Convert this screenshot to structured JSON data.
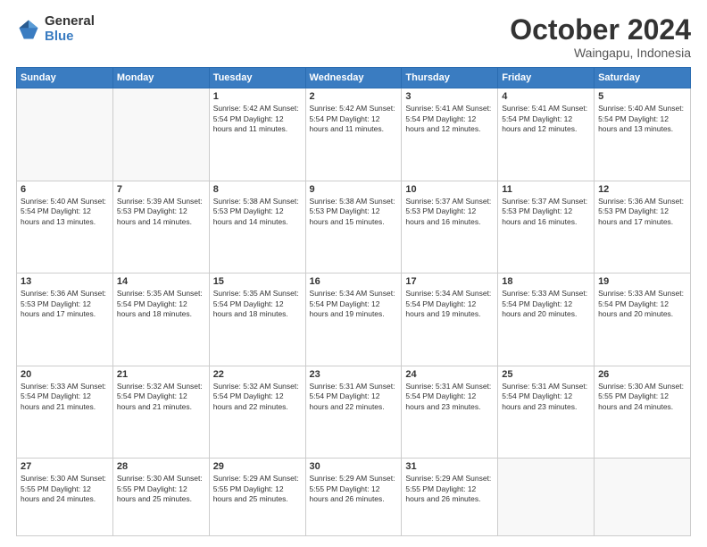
{
  "logo": {
    "general": "General",
    "blue": "Blue"
  },
  "header": {
    "month": "October 2024",
    "location": "Waingapu, Indonesia"
  },
  "weekdays": [
    "Sunday",
    "Monday",
    "Tuesday",
    "Wednesday",
    "Thursday",
    "Friday",
    "Saturday"
  ],
  "weeks": [
    [
      {
        "day": "",
        "info": ""
      },
      {
        "day": "",
        "info": ""
      },
      {
        "day": "1",
        "info": "Sunrise: 5:42 AM\nSunset: 5:54 PM\nDaylight: 12 hours\nand 11 minutes."
      },
      {
        "day": "2",
        "info": "Sunrise: 5:42 AM\nSunset: 5:54 PM\nDaylight: 12 hours\nand 11 minutes."
      },
      {
        "day": "3",
        "info": "Sunrise: 5:41 AM\nSunset: 5:54 PM\nDaylight: 12 hours\nand 12 minutes."
      },
      {
        "day": "4",
        "info": "Sunrise: 5:41 AM\nSunset: 5:54 PM\nDaylight: 12 hours\nand 12 minutes."
      },
      {
        "day": "5",
        "info": "Sunrise: 5:40 AM\nSunset: 5:54 PM\nDaylight: 12 hours\nand 13 minutes."
      }
    ],
    [
      {
        "day": "6",
        "info": "Sunrise: 5:40 AM\nSunset: 5:54 PM\nDaylight: 12 hours\nand 13 minutes."
      },
      {
        "day": "7",
        "info": "Sunrise: 5:39 AM\nSunset: 5:53 PM\nDaylight: 12 hours\nand 14 minutes."
      },
      {
        "day": "8",
        "info": "Sunrise: 5:38 AM\nSunset: 5:53 PM\nDaylight: 12 hours\nand 14 minutes."
      },
      {
        "day": "9",
        "info": "Sunrise: 5:38 AM\nSunset: 5:53 PM\nDaylight: 12 hours\nand 15 minutes."
      },
      {
        "day": "10",
        "info": "Sunrise: 5:37 AM\nSunset: 5:53 PM\nDaylight: 12 hours\nand 16 minutes."
      },
      {
        "day": "11",
        "info": "Sunrise: 5:37 AM\nSunset: 5:53 PM\nDaylight: 12 hours\nand 16 minutes."
      },
      {
        "day": "12",
        "info": "Sunrise: 5:36 AM\nSunset: 5:53 PM\nDaylight: 12 hours\nand 17 minutes."
      }
    ],
    [
      {
        "day": "13",
        "info": "Sunrise: 5:36 AM\nSunset: 5:53 PM\nDaylight: 12 hours\nand 17 minutes."
      },
      {
        "day": "14",
        "info": "Sunrise: 5:35 AM\nSunset: 5:54 PM\nDaylight: 12 hours\nand 18 minutes."
      },
      {
        "day": "15",
        "info": "Sunrise: 5:35 AM\nSunset: 5:54 PM\nDaylight: 12 hours\nand 18 minutes."
      },
      {
        "day": "16",
        "info": "Sunrise: 5:34 AM\nSunset: 5:54 PM\nDaylight: 12 hours\nand 19 minutes."
      },
      {
        "day": "17",
        "info": "Sunrise: 5:34 AM\nSunset: 5:54 PM\nDaylight: 12 hours\nand 19 minutes."
      },
      {
        "day": "18",
        "info": "Sunrise: 5:33 AM\nSunset: 5:54 PM\nDaylight: 12 hours\nand 20 minutes."
      },
      {
        "day": "19",
        "info": "Sunrise: 5:33 AM\nSunset: 5:54 PM\nDaylight: 12 hours\nand 20 minutes."
      }
    ],
    [
      {
        "day": "20",
        "info": "Sunrise: 5:33 AM\nSunset: 5:54 PM\nDaylight: 12 hours\nand 21 minutes."
      },
      {
        "day": "21",
        "info": "Sunrise: 5:32 AM\nSunset: 5:54 PM\nDaylight: 12 hours\nand 21 minutes."
      },
      {
        "day": "22",
        "info": "Sunrise: 5:32 AM\nSunset: 5:54 PM\nDaylight: 12 hours\nand 22 minutes."
      },
      {
        "day": "23",
        "info": "Sunrise: 5:31 AM\nSunset: 5:54 PM\nDaylight: 12 hours\nand 22 minutes."
      },
      {
        "day": "24",
        "info": "Sunrise: 5:31 AM\nSunset: 5:54 PM\nDaylight: 12 hours\nand 23 minutes."
      },
      {
        "day": "25",
        "info": "Sunrise: 5:31 AM\nSunset: 5:54 PM\nDaylight: 12 hours\nand 23 minutes."
      },
      {
        "day": "26",
        "info": "Sunrise: 5:30 AM\nSunset: 5:55 PM\nDaylight: 12 hours\nand 24 minutes."
      }
    ],
    [
      {
        "day": "27",
        "info": "Sunrise: 5:30 AM\nSunset: 5:55 PM\nDaylight: 12 hours\nand 24 minutes."
      },
      {
        "day": "28",
        "info": "Sunrise: 5:30 AM\nSunset: 5:55 PM\nDaylight: 12 hours\nand 25 minutes."
      },
      {
        "day": "29",
        "info": "Sunrise: 5:29 AM\nSunset: 5:55 PM\nDaylight: 12 hours\nand 25 minutes."
      },
      {
        "day": "30",
        "info": "Sunrise: 5:29 AM\nSunset: 5:55 PM\nDaylight: 12 hours\nand 26 minutes."
      },
      {
        "day": "31",
        "info": "Sunrise: 5:29 AM\nSunset: 5:55 PM\nDaylight: 12 hours\nand 26 minutes."
      },
      {
        "day": "",
        "info": ""
      },
      {
        "day": "",
        "info": ""
      }
    ]
  ]
}
